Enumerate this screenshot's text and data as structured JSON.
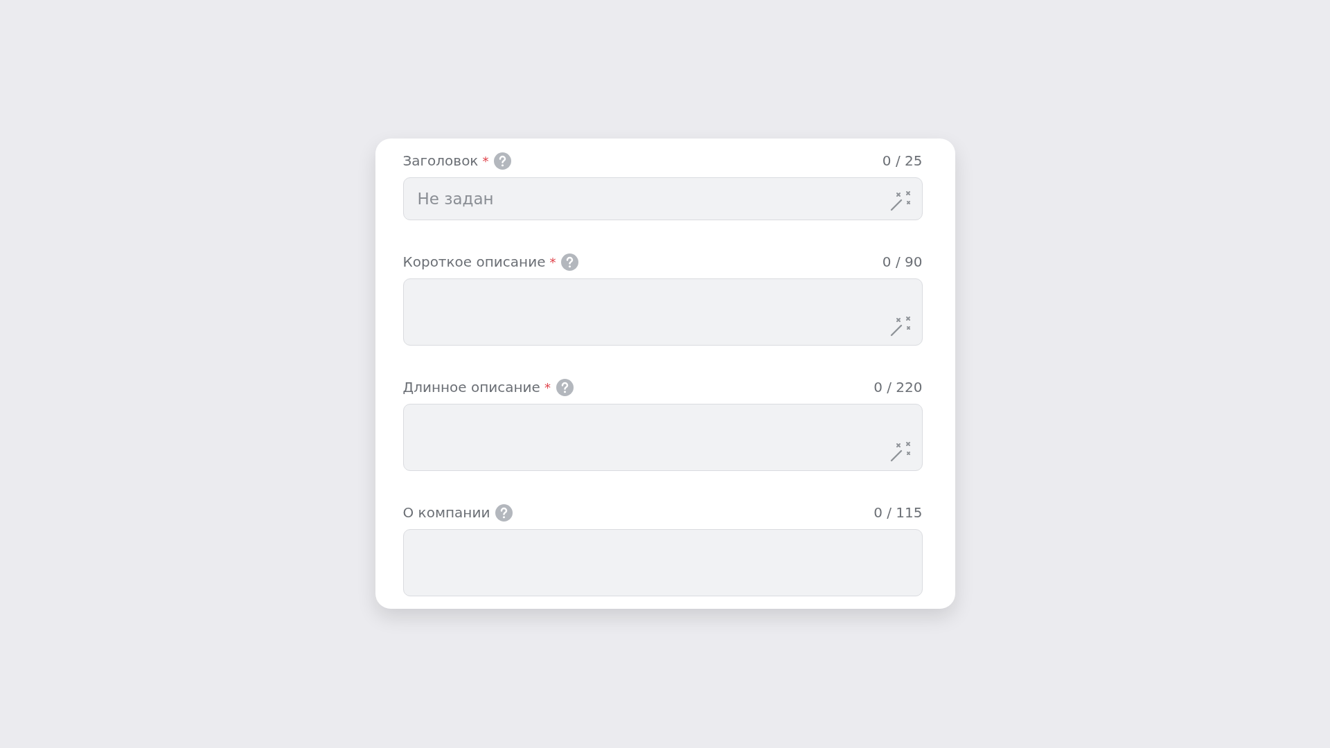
{
  "fields": [
    {
      "kind": "input",
      "label": "Заголовок",
      "required_mark": "*",
      "help": true,
      "counter": "0 / 25",
      "placeholder": "Не задан",
      "magic": true
    },
    {
      "kind": "textarea",
      "label": "Короткое описание",
      "required_mark": "*",
      "help": true,
      "counter": "0 / 90",
      "magic": true
    },
    {
      "kind": "textarea",
      "label": "Длинное описание",
      "required_mark": "*",
      "help": true,
      "counter": "0 / 220",
      "magic": true
    },
    {
      "kind": "textarea",
      "label": "О компании",
      "help": true,
      "counter": "0 / 115",
      "magic": false
    }
  ]
}
